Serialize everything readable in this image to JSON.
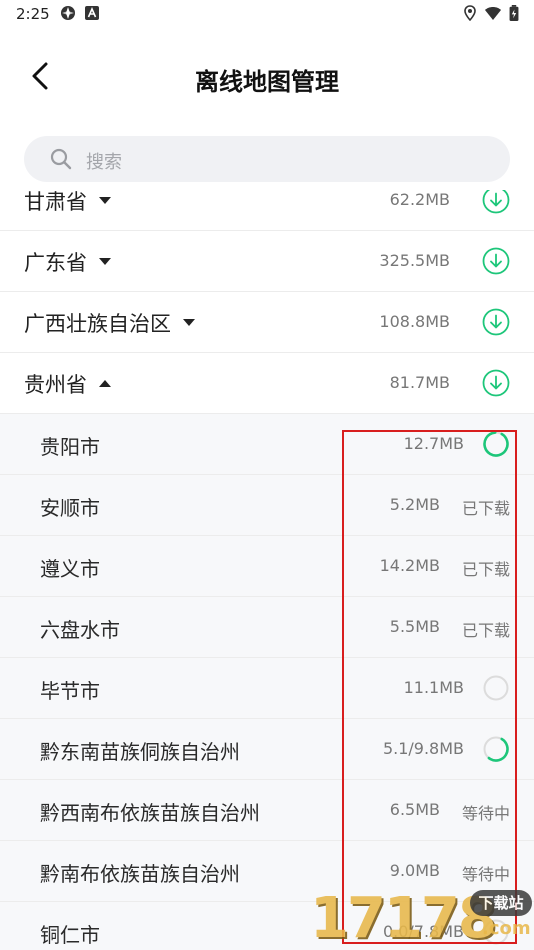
{
  "status_bar": {
    "time": "2:25"
  },
  "header": {
    "title": "离线地图管理"
  },
  "search": {
    "placeholder": "搜索"
  },
  "colors": {
    "accent_green": "#1dc67a",
    "annotation_red": "#d81e1e"
  },
  "list": {
    "rows": [
      {
        "type": "province",
        "name": "甘肃省",
        "size": "62.2MB",
        "expanded": false,
        "action": "download-icon"
      },
      {
        "type": "province",
        "name": "广东省",
        "size": "325.5MB",
        "expanded": false,
        "action": "download-icon"
      },
      {
        "type": "province",
        "name": "广西壮族自治区",
        "size": "108.8MB",
        "expanded": false,
        "action": "download-icon"
      },
      {
        "type": "province",
        "name": "贵州省",
        "size": "81.7MB",
        "expanded": true,
        "action": "download-icon"
      },
      {
        "type": "city",
        "name": "贵阳市",
        "size": "12.7MB",
        "status": "",
        "progress": 0.9
      },
      {
        "type": "city",
        "name": "安顺市",
        "size": "5.2MB",
        "status": "已下载"
      },
      {
        "type": "city",
        "name": "遵义市",
        "size": "14.2MB",
        "status": "已下载"
      },
      {
        "type": "city",
        "name": "六盘水市",
        "size": "5.5MB",
        "status": "已下载"
      },
      {
        "type": "city",
        "name": "毕节市",
        "size": "11.1MB",
        "status": "",
        "progress": 0
      },
      {
        "type": "city",
        "name": "黔东南苗族侗族自治州",
        "size": "5.1/9.8MB",
        "status": "",
        "progress": 0.52
      },
      {
        "type": "city",
        "name": "黔西南布依族苗族自治州",
        "size": "6.5MB",
        "status": "等待中"
      },
      {
        "type": "city",
        "name": "黔南布依族苗族自治州",
        "size": "9.0MB",
        "status": "等待中"
      },
      {
        "type": "city",
        "name": "铜仁市",
        "size": "0.0/7.8MB",
        "status": "",
        "progress": 0
      }
    ]
  },
  "watermark": {
    "digits": "17178",
    "badge": "下载站",
    "suffix": ".com"
  }
}
